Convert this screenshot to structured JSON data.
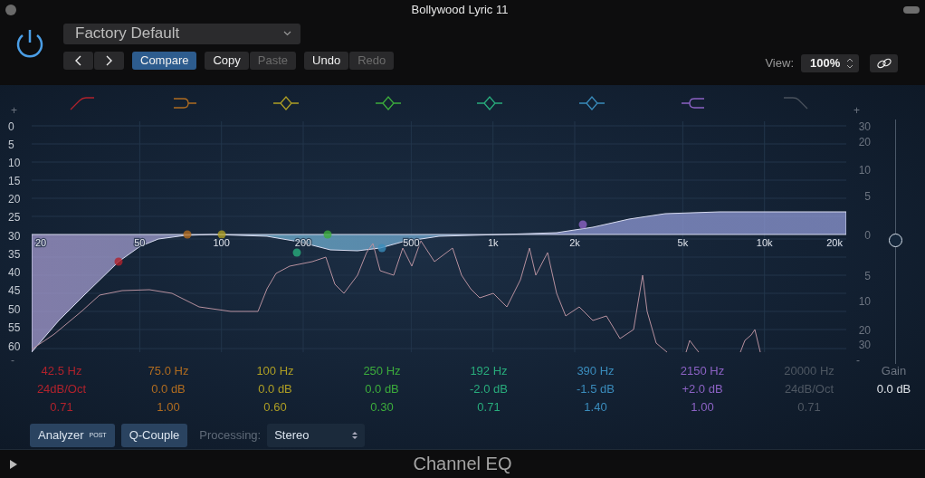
{
  "window": {
    "title": "Bollywood Lyric 11"
  },
  "header": {
    "power_on": true,
    "preset": "Factory Default",
    "buttons": [
      {
        "label": "Compare",
        "selected": true,
        "disabled": false
      },
      {
        "label": "Copy",
        "selected": false,
        "disabled": false
      },
      {
        "label": "Paste",
        "selected": false,
        "disabled": true
      },
      {
        "label": "Undo",
        "selected": false,
        "disabled": false
      },
      {
        "label": "Redo",
        "selected": false,
        "disabled": true
      }
    ],
    "view_label": "View:",
    "zoom": "100%"
  },
  "graph": {
    "left_scale": [
      "+",
      "0",
      "5",
      "10",
      "15",
      "20",
      "25",
      "30",
      "35",
      "40",
      "45",
      "50",
      "55",
      "60",
      "-"
    ],
    "right_scale": [
      "+",
      "30",
      "20",
      "10",
      "5",
      "0",
      "5",
      "10",
      "20",
      "30",
      "-"
    ],
    "frequencies": [
      "20",
      "50",
      "100",
      "200",
      "500",
      "1k",
      "2k",
      "5k",
      "10k",
      "20k"
    ],
    "gain_slider": {
      "level": 0.5
    }
  },
  "bands": [
    {
      "kind": "lowcut",
      "color": "#b0222c",
      "on": true,
      "frequency": "42.5 Hz",
      "gain": "24dB/Oct",
      "q": "0.71"
    },
    {
      "kind": "lowshelf",
      "color": "#b06c20",
      "on": true,
      "frequency": "75.0 Hz",
      "gain": "0.0 dB",
      "q": "1.00"
    },
    {
      "kind": "bell",
      "color": "#ae9e24",
      "on": true,
      "frequency": "100 Hz",
      "gain": "0.0 dB",
      "q": "0.60"
    },
    {
      "kind": "bell",
      "color": "#3cac3c",
      "on": true,
      "frequency": "250 Hz",
      "gain": "0.0 dB",
      "q": "0.30"
    },
    {
      "kind": "bell",
      "color": "#28ac7c",
      "on": true,
      "frequency": "192 Hz",
      "gain": "-2.0 dB",
      "q": "0.71"
    },
    {
      "kind": "bell",
      "color": "#3a8cbc",
      "on": true,
      "frequency": "390 Hz",
      "gain": "-1.5 dB",
      "q": "1.40"
    },
    {
      "kind": "highshelf",
      "color": "#8c62c4",
      "on": true,
      "frequency": "2150 Hz",
      "gain": "+2.0 dB",
      "q": "1.00"
    },
    {
      "kind": "highcut",
      "color": "#4e5762",
      "on": false,
      "frequency": "20000 Hz",
      "gain": "24dB/Oct",
      "q": "0.71"
    }
  ],
  "gain": {
    "label": "Gain",
    "value": "0.0 dB"
  },
  "controls": {
    "analyzer": {
      "label": "Analyzer",
      "badge": "POST"
    },
    "q_couple": "Q-Couple",
    "processing_label": "Processing:",
    "processing": "Stereo"
  },
  "footer": {
    "title": "Channel EQ"
  }
}
